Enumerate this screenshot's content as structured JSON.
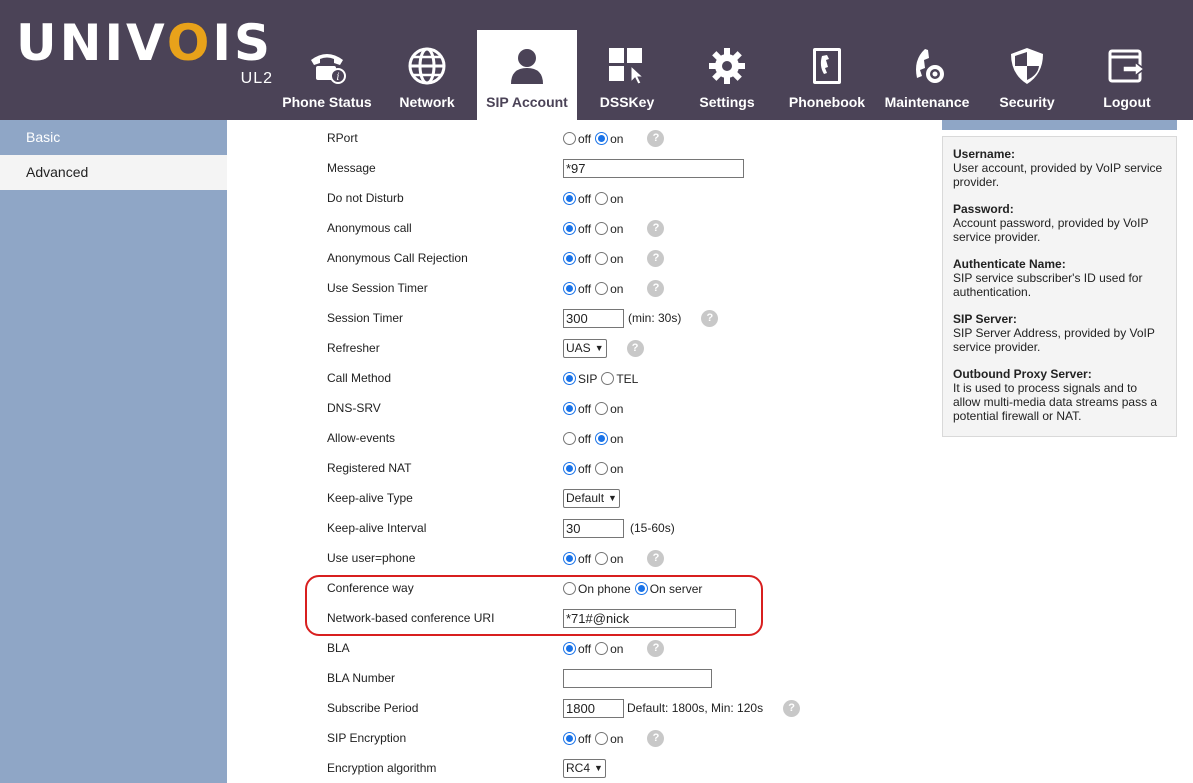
{
  "brand": {
    "logo_pre": "UNIV",
    "logo_o": "O",
    "logo_post": "IS",
    "model": "UL2"
  },
  "nav": [
    {
      "label": "Phone Status",
      "icon": "phone-status-icon",
      "active": false
    },
    {
      "label": "Network",
      "icon": "globe-icon",
      "active": false
    },
    {
      "label": "SIP Account",
      "icon": "user-icon",
      "active": true
    },
    {
      "label": "DSSKey",
      "icon": "dsskey-icon",
      "active": false
    },
    {
      "label": "Settings",
      "icon": "gear-icon",
      "active": false
    },
    {
      "label": "Phonebook",
      "icon": "phonebook-icon",
      "active": false
    },
    {
      "label": "Maintenance",
      "icon": "maintenance-icon",
      "active": false
    },
    {
      "label": "Security",
      "icon": "shield-icon",
      "active": false
    },
    {
      "label": "Logout",
      "icon": "logout-icon",
      "active": false
    }
  ],
  "sidebar": {
    "basic": "Basic",
    "advanced": "Advanced"
  },
  "form": {
    "rport": {
      "label": "RPort",
      "off": "off",
      "on": "on",
      "selected": "on"
    },
    "message": {
      "label": "Message",
      "value": "*97"
    },
    "dnd": {
      "label": "Do not Disturb",
      "off": "off",
      "on": "on",
      "selected": "off"
    },
    "anon_call": {
      "label": "Anonymous call",
      "off": "off",
      "on": "on",
      "selected": "off"
    },
    "anon_reject": {
      "label": "Anonymous Call Rejection",
      "off": "off",
      "on": "on",
      "selected": "off"
    },
    "session_timer_use": {
      "label": "Use Session Timer",
      "off": "off",
      "on": "on",
      "selected": "off"
    },
    "session_timer": {
      "label": "Session Timer",
      "value": "300",
      "note": "(min: 30s)"
    },
    "refresher": {
      "label": "Refresher",
      "value": "UAS"
    },
    "call_method": {
      "label": "Call Method",
      "a": "SIP",
      "b": "TEL",
      "selected": "SIP"
    },
    "dns_srv": {
      "label": "DNS-SRV",
      "off": "off",
      "on": "on",
      "selected": "off"
    },
    "allow_events": {
      "label": "Allow-events",
      "off": "off",
      "on": "on",
      "selected": "on"
    },
    "registered_nat": {
      "label": "Registered NAT",
      "off": "off",
      "on": "on",
      "selected": "off"
    },
    "keepalive_type": {
      "label": "Keep-alive Type",
      "value": "Default"
    },
    "keepalive_interval": {
      "label": "Keep-alive Interval",
      "value": "30",
      "note": "(15-60s)"
    },
    "user_phone": {
      "label": "Use user=phone",
      "off": "off",
      "on": "on",
      "selected": "off"
    },
    "conference_way": {
      "label": "Conference way",
      "a": "On phone",
      "b": "On server",
      "selected": "On server"
    },
    "conference_uri": {
      "label": "Network-based conference URI",
      "value": "*71#@nick"
    },
    "bla": {
      "label": "BLA",
      "off": "off",
      "on": "on",
      "selected": "off"
    },
    "bla_number": {
      "label": "BLA Number",
      "value": ""
    },
    "subscribe_period": {
      "label": "Subscribe Period",
      "value": "1800",
      "note": "Default: 1800s, Min: 120s"
    },
    "sip_encryption": {
      "label": "SIP Encryption",
      "off": "off",
      "on": "on",
      "selected": "off"
    },
    "encryption_algorithm": {
      "label": "Encryption algorithm",
      "value": "RC4"
    },
    "help_glyph": "?"
  },
  "help": [
    {
      "title": "Username:",
      "desc": "User account, provided by VoIP service provider."
    },
    {
      "title": "Password:",
      "desc": "Account password, provided by VoIP service provider."
    },
    {
      "title": "Authenticate Name:",
      "desc": "SIP service subscriber's ID used for authentication."
    },
    {
      "title": "SIP Server:",
      "desc": "SIP Server Address, provided by VoIP service provider."
    },
    {
      "title": "Outbound Proxy Server:",
      "desc": "It is used to process signals and to allow multi-media data streams pass a potential firewall or NAT."
    }
  ],
  "colors": {
    "header": "#4b4357",
    "sidebar": "#8fa6c6",
    "accent": "#e8a21a",
    "highlight": "#d81f1f",
    "radio": "#1a73e8"
  }
}
